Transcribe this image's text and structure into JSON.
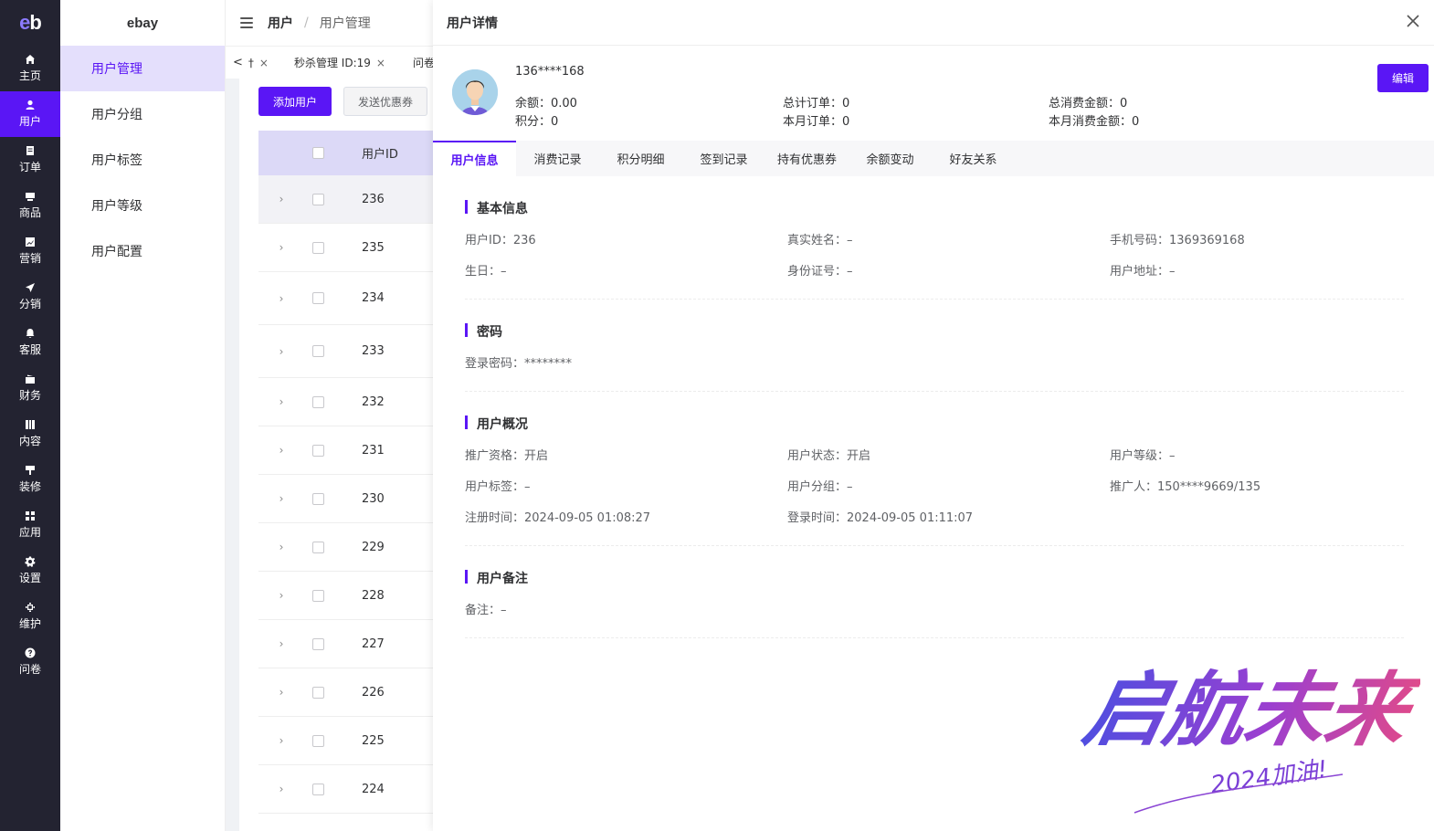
{
  "rail": {
    "logo": [
      "e",
      "b"
    ],
    "items": [
      {
        "label": "主页",
        "icon": "home-icon"
      },
      {
        "label": "用户",
        "icon": "user-icon",
        "active": true
      },
      {
        "label": "订单",
        "icon": "order-icon"
      },
      {
        "label": "商品",
        "icon": "goods-icon"
      },
      {
        "label": "营销",
        "icon": "marketing-icon"
      },
      {
        "label": "分销",
        "icon": "send-icon"
      },
      {
        "label": "客服",
        "icon": "bell-icon"
      },
      {
        "label": "财务",
        "icon": "wallet-icon"
      },
      {
        "label": "内容",
        "icon": "book-icon"
      },
      {
        "label": "装修",
        "icon": "brush-icon"
      },
      {
        "label": "应用",
        "icon": "grid-icon"
      },
      {
        "label": "设置",
        "icon": "gear-icon"
      },
      {
        "label": "维护",
        "icon": "chip-icon"
      },
      {
        "label": "问卷",
        "icon": "question-icon"
      }
    ]
  },
  "submenu": {
    "title": "ebay",
    "items": [
      "用户管理",
      "用户分组",
      "用户标签",
      "用户等级",
      "用户配置"
    ]
  },
  "topbar": {
    "crumb_parent": "用户",
    "crumb_sep": "/",
    "crumb_current": "用户管理"
  },
  "tabsbar": {
    "prev": "<",
    "home": "†",
    "tabs": [
      {
        "label": "秒杀管理 ID:19"
      },
      {
        "label": "问卷"
      }
    ],
    "close": "×"
  },
  "list": {
    "add_button": "添加用户",
    "coupon_button": "发送优惠券",
    "column_id": "用户ID",
    "expand_glyph": "›",
    "rows": [
      "236",
      "235",
      "234",
      "233",
      "232",
      "231",
      "230",
      "229",
      "228",
      "227",
      "226",
      "225",
      "224"
    ]
  },
  "drawer": {
    "title": "用户详情",
    "profile": {
      "name": "136****168",
      "balance": "余额：0.00",
      "points": "积分：0",
      "total_orders": "总计订单：0",
      "month_orders": "本月订单：0",
      "total_spent": "总消费金额：0",
      "month_spent": "本月消费金额：0"
    },
    "edit_button": "编辑",
    "tabs": [
      "用户信息",
      "消费记录",
      "积分明细",
      "签到记录",
      "持有优惠券",
      "余额变动",
      "好友关系"
    ],
    "sections": {
      "basic": {
        "title": "基本信息",
        "user_id": "用户ID：236",
        "real_name": "真实姓名：–",
        "phone": "手机号码：1369369168",
        "birthday": "生日：–",
        "id_card": "身份证号：–",
        "address": "用户地址：–"
      },
      "password": {
        "title": "密码",
        "login_password": "登录密码：********"
      },
      "overview": {
        "title": "用户概况",
        "promotion": "推广资格：开启",
        "status": "用户状态：开启",
        "level": "用户等级：–",
        "tag": "用户标签：–",
        "group": "用户分组：–",
        "promoter": "推广人：150****9669/135",
        "register_time": "注册时间：2024-09-05 01:08:27",
        "login_time": "登录时间：2024-09-05 01:11:07"
      },
      "remark": {
        "title": "用户备注",
        "remark": "备注：–"
      }
    }
  },
  "stamp": {
    "main": "启航未来",
    "sub": "2024加油!"
  },
  "colors": {
    "accent": "#5a16f5",
    "rail_bg": "#232331",
    "submenu_active_bg": "#e4dffc"
  }
}
